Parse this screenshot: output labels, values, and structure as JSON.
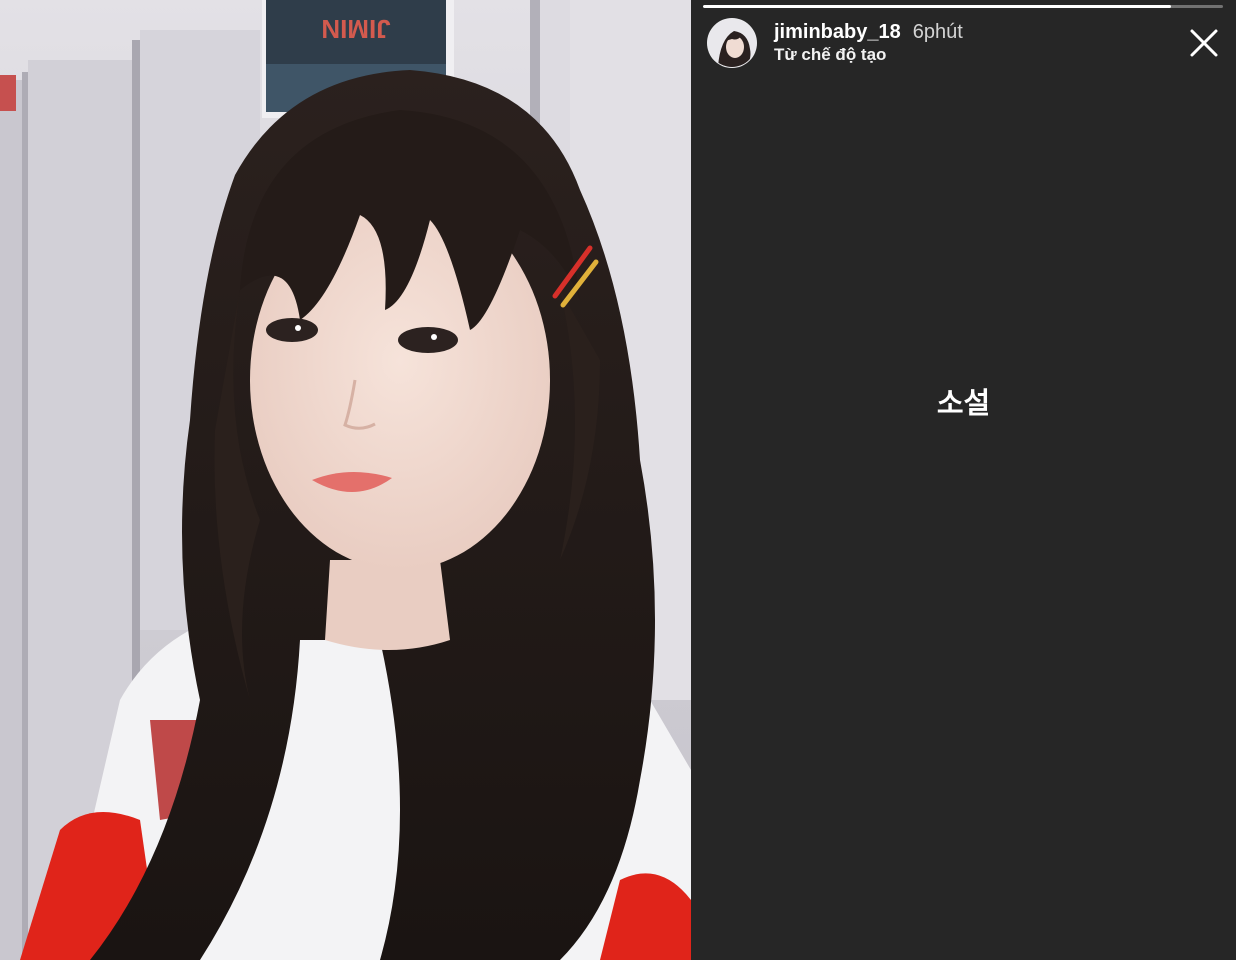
{
  "story": {
    "username": "jiminbaby_18",
    "time_ago": "6phút",
    "subtitle": "Từ chế độ tạo",
    "text": "소설",
    "progress": 0.9,
    "close_icon": "close-icon"
  },
  "photo": {
    "sign_text": "JIMIN"
  },
  "colors": {
    "story_background": "#262626",
    "text": "#ffffff",
    "progress_track": "rgba(255,255,255,0.35)",
    "progress_fill": "#ffffff"
  }
}
